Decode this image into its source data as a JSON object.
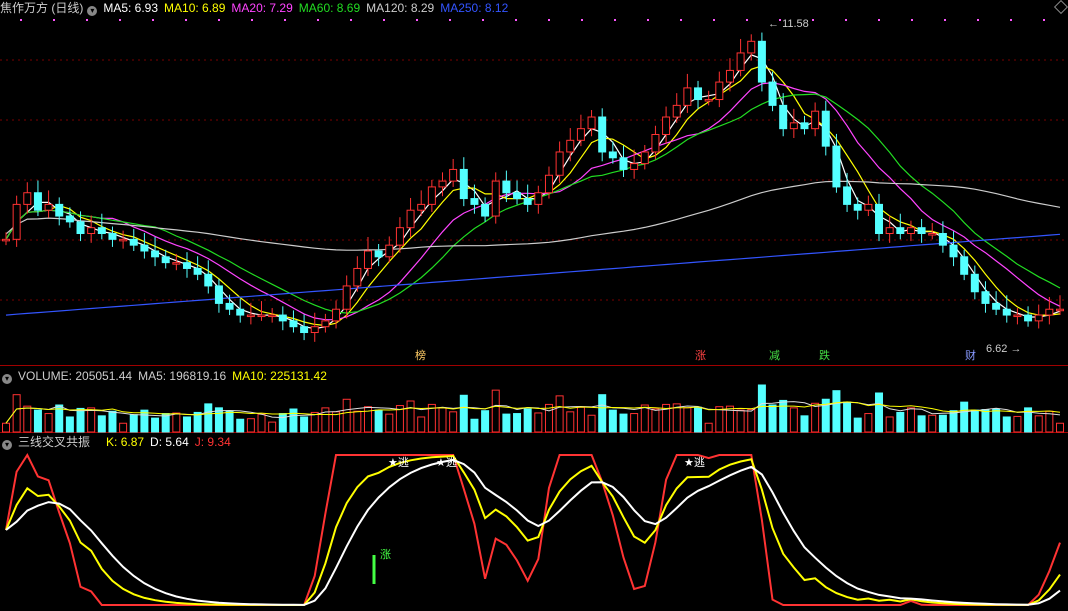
{
  "price_panel": {
    "title": "焦作万方 (日线)",
    "ma": [
      {
        "label": "MA5: 6.93",
        "color": "#ffffff"
      },
      {
        "label": "MA10: 6.89",
        "color": "#ffff00"
      },
      {
        "label": "MA20: 7.29",
        "color": "#ff44ff"
      },
      {
        "label": "MA60: 8.69",
        "color": "#22dd22"
      },
      {
        "label": "MA120: 8.29",
        "color": "#cccccc"
      },
      {
        "label": "MA250: 8.12",
        "color": "#3355ff"
      }
    ],
    "high_label": "11.58",
    "low_label": "6.62",
    "signals": [
      {
        "text": "榜",
        "color": "#ffcc66"
      },
      {
        "text": "涨",
        "color": "#ff4444"
      },
      {
        "text": "减",
        "color": "#44dd44"
      },
      {
        "text": "跌",
        "color": "#44dd44"
      },
      {
        "text": "财",
        "color": "#8899ff"
      }
    ]
  },
  "volume_panel": {
    "label": "VOLUME: 205051.44",
    "ma5": "MA5: 196819.16",
    "ma10": "MA10: 225131.42",
    "colors": {
      "label": "#cccccc",
      "ma5": "#cccccc",
      "ma10": "#ffff00"
    }
  },
  "indicator_panel": {
    "name": "三线交叉共振",
    "k": "K: 6.87",
    "d": "D: 5.64",
    "j": "J: 9.34",
    "colors": {
      "k": "#ffff00",
      "d": "#ffffff",
      "j": "#ff3333"
    },
    "escape_label": "★逃",
    "rise_label": "涨"
  },
  "chart_data": {
    "type": "candlestick",
    "title": "焦作万方 (日线)",
    "high": 11.58,
    "low": 6.62,
    "last_close": 6.93,
    "ma_latest": {
      "MA5": 6.93,
      "MA10": 6.89,
      "MA20": 7.29,
      "MA60": 8.69,
      "MA120": 8.29,
      "MA250": 8.12
    },
    "volume_latest": 205051.44,
    "volume_ma": {
      "MA5": 196819.16,
      "MA10": 225131.42
    },
    "kdj_latest": {
      "K": 6.87,
      "D": 5.64,
      "J": 9.34
    },
    "closes": [
      8.1,
      8.7,
      8.9,
      8.6,
      8.7,
      8.5,
      8.4,
      8.2,
      8.3,
      8.2,
      8.1,
      8.1,
      8.0,
      7.9,
      7.8,
      7.7,
      7.7,
      7.6,
      7.5,
      7.3,
      7.0,
      6.9,
      6.8,
      6.8,
      6.8,
      6.8,
      6.7,
      6.6,
      6.5,
      6.6,
      6.7,
      6.9,
      7.3,
      7.6,
      7.9,
      7.8,
      8.0,
      8.3,
      8.6,
      8.7,
      9.0,
      9.1,
      9.3,
      8.8,
      8.7,
      8.5,
      9.1,
      8.9,
      8.8,
      8.7,
      8.9,
      9.2,
      9.6,
      9.8,
      10.0,
      10.2,
      9.6,
      9.5,
      9.3,
      9.4,
      9.6,
      9.9,
      10.2,
      10.4,
      10.7,
      10.5,
      10.5,
      10.8,
      11.0,
      11.3,
      11.5,
      10.8,
      10.4,
      10.0,
      10.1,
      10.0,
      10.3,
      9.7,
      9.0,
      8.7,
      8.6,
      8.7,
      8.2,
      8.3,
      8.2,
      8.3,
      8.2,
      8.2,
      8.0,
      7.8,
      7.5,
      7.2,
      7.0,
      6.9,
      6.8,
      6.8,
      6.7,
      6.8,
      6.9,
      6.9
    ]
  }
}
